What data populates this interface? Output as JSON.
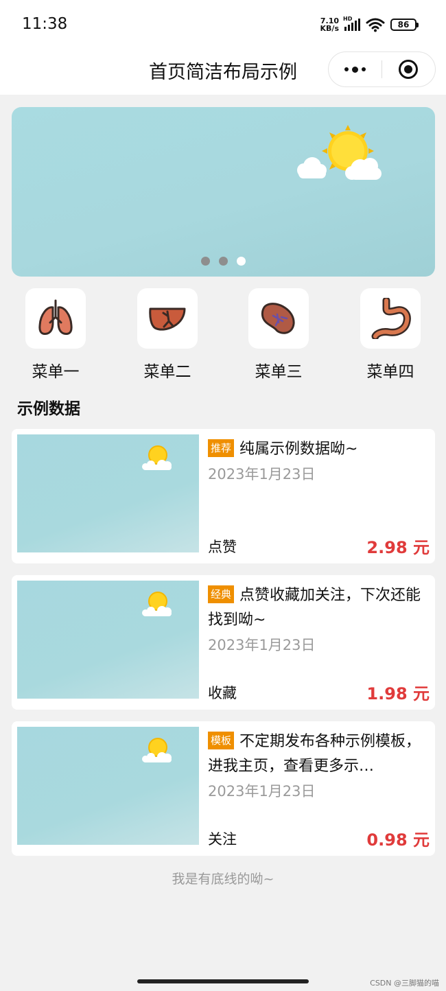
{
  "status_bar": {
    "time": "11:38",
    "net_speed_value": "7.10",
    "net_speed_unit": "KB/s",
    "signal_label": "HD",
    "battery": "86"
  },
  "nav": {
    "title": "首页简洁布局示例",
    "more_icon": "more-dots-icon",
    "close_icon": "target-icon"
  },
  "banner": {
    "dots": 3,
    "active_dot": 2
  },
  "menu": {
    "items": [
      {
        "label": "菜单一",
        "icon": "lungs-icon"
      },
      {
        "label": "菜单二",
        "icon": "liver-icon"
      },
      {
        "label": "菜单三",
        "icon": "kidney-icon"
      },
      {
        "label": "菜单四",
        "icon": "stomach-icon"
      }
    ]
  },
  "section": {
    "title": "示例数据"
  },
  "list": [
    {
      "tag": "推荐",
      "title": "纯属示例数据呦~",
      "date": "2023年1月23日",
      "action": "点赞",
      "price": "2.98 元"
    },
    {
      "tag": "经典",
      "title": "点赞收藏加关注，下次还能找到呦~",
      "date": "2023年1月23日",
      "action": "收藏",
      "price": "1.98 元"
    },
    {
      "tag": "模板",
      "title": "不定期发布各种示例模板，进我主页，查看更多示…",
      "date": "2023年1月23日",
      "action": "关注",
      "price": "0.98 元"
    }
  ],
  "footer": {
    "text": "我是有底线的呦~"
  },
  "watermark": "CSDN @三脚猫的喵",
  "colors": {
    "tag_bg": "#ef8f00",
    "price": "#e03b3b",
    "page_bg": "#f1f1f1",
    "banner_bg": "#a9dbe1"
  }
}
